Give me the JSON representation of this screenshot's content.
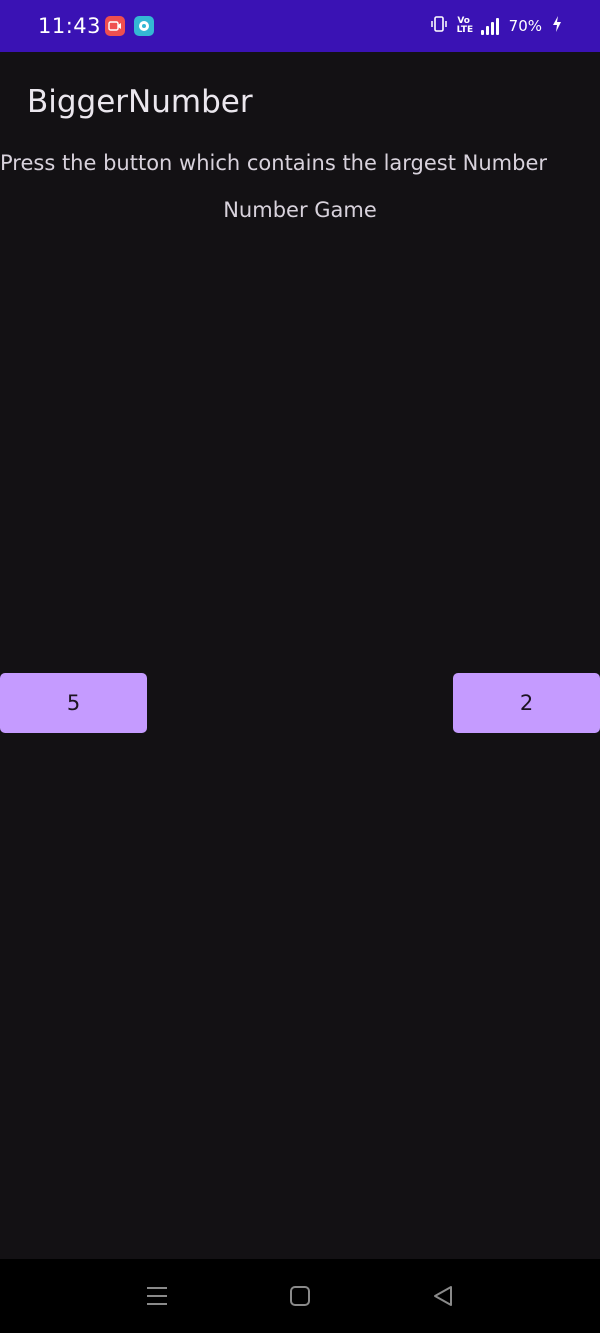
{
  "status_bar": {
    "time": "11:43",
    "battery": "70%",
    "network_label": "Vo LTE",
    "background_color": "#3a12b4",
    "icons": [
      "screen-recorder-icon",
      "chat-app-icon",
      "vibrate-icon",
      "volte-icon",
      "signal-icon",
      "battery-charging-icon"
    ]
  },
  "app": {
    "title": "BiggerNumber",
    "instruction": "Press the button which contains the largest Number",
    "game_label": "Number Game",
    "left_button_value": "5",
    "right_button_value": "2",
    "button_color": "#c59bff",
    "background_color": "#131114"
  },
  "nav_bar": {
    "icons": [
      "recent-apps-icon",
      "home-icon",
      "back-icon"
    ]
  }
}
